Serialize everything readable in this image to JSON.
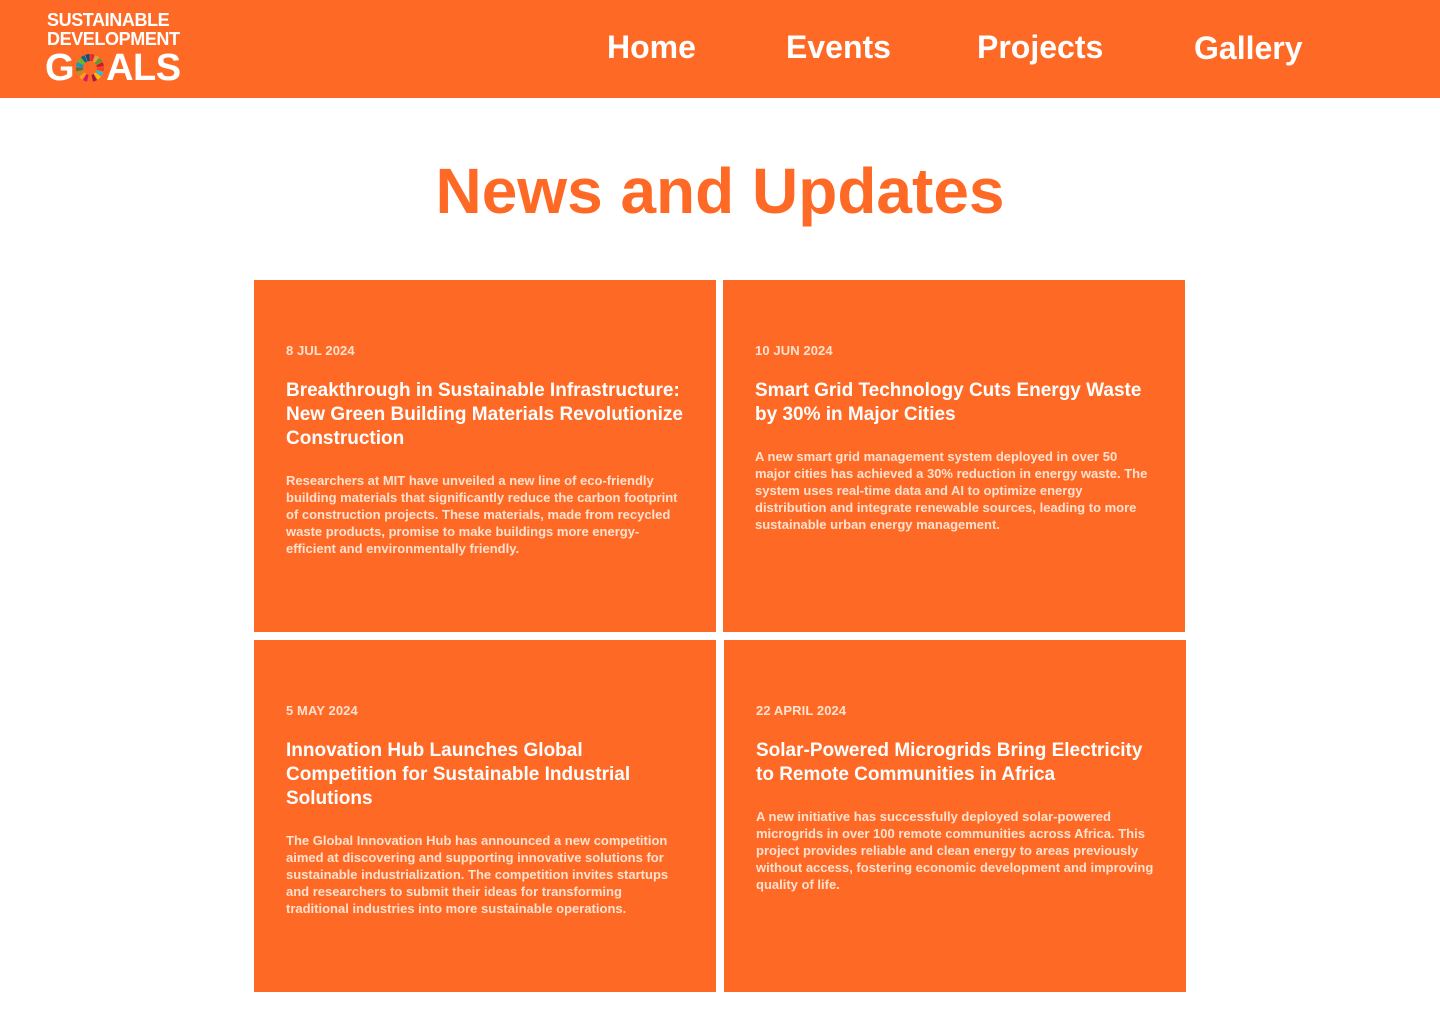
{
  "header": {
    "logo": {
      "line1": "SUSTAINABLE",
      "line2": "DEVELOPMENT",
      "line3_prefix": "G",
      "line3_suffix": "ALS"
    },
    "nav": [
      {
        "label": "Home"
      },
      {
        "label": "Events"
      },
      {
        "label": "Projects"
      },
      {
        "label": "Gallery"
      }
    ]
  },
  "main": {
    "title": "News and Updates",
    "cards": [
      {
        "date": "8 JUL 2024",
        "title": "Breakthrough in Sustainable Infrastructure: New Green Building Materials Revolutionize Construction",
        "description": "Researchers at MIT have unveiled a new line of eco-friendly building materials that significantly reduce the carbon footprint of construction projects. These materials, made from recycled waste products, promise to make buildings more energy-efficient and environmentally friendly."
      },
      {
        "date": "10 JUN 2024",
        "title": "Smart Grid Technology Cuts Energy Waste by 30% in Major Cities",
        "description": "A new smart grid management system deployed in over 50 major cities has achieved a 30% reduction in energy waste. The system uses real-time data and AI to optimize energy distribution and integrate renewable sources, leading to more sustainable urban energy management."
      },
      {
        "date": "5 MAY 2024",
        "title": "Innovation Hub Launches Global Competition for Sustainable Industrial Solutions",
        "description": "The Global Innovation Hub has announced a new competition aimed at discovering and supporting innovative solutions for sustainable industrialization. The competition invites startups and researchers to submit their ideas for transforming traditional industries into more sustainable operations."
      },
      {
        "date": "22 APRIL 2024",
        "title": "Solar-Powered Microgrids Bring Electricity to Remote Communities in Africa",
        "description": "A new initiative has successfully deployed solar-powered microgrids in over 100 remote communities across Africa. This project provides reliable and clean energy to areas previously without access, fostering economic development and improving quality of life."
      }
    ]
  },
  "colors": {
    "brand_orange": "#fe6a25",
    "text_white": "#ffffff",
    "text_light": "#ffe1cf",
    "background": "#ffffff"
  }
}
